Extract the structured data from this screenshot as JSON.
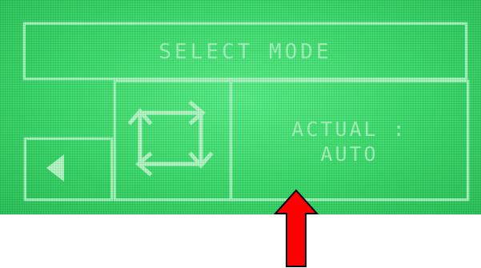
{
  "screen": {
    "title": "SELECT MODE",
    "status_label": "ACTUAL :",
    "status_value": "AUTO"
  },
  "icons": {
    "back": "left-triangle-icon",
    "mode": "cycle-arrows-icon",
    "annotation": "red-up-arrow-icon"
  },
  "colors": {
    "lcd_background": "#3fdc6f",
    "lcd_text": "#a6f7bd",
    "annotation_arrow": "#ff0000"
  }
}
